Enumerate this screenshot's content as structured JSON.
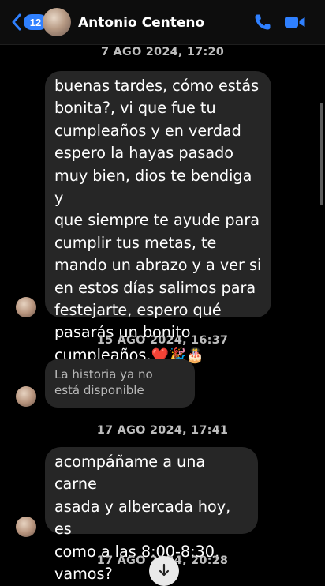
{
  "header": {
    "back_count": "12",
    "contact_name": "Antonio Centeno"
  },
  "messages": [
    {
      "timestamp": "7 AGO 2024, 17:20",
      "text": "buenas tardes, cómo estás\nbonita?, vi que fue tu\ncumpleaños y en verdad\nespero la hayas pasado\nmuy bien, dios te bendiga y\nque siempre te ayude para\ncumplir tus metas, te\nmando un abrazo y a ver si\nen estos días salimos para\nfestejarte, espero qué\npasarás un bonito\ncumpleaños.",
      "emojis": "❤️🎉🎂"
    },
    {
      "timestamp": "15 AGO 2024, 16:37",
      "text": "La historia ya no\nestá disponible"
    },
    {
      "timestamp": "17 AGO 2024, 17:41",
      "text": "acompáñame a una carne\nasada y albercada hoy, es\ncomo a las 8:00-8:30,\nvamos?"
    },
    {
      "timestamp": "17 AGO 2024, 20:28"
    }
  ],
  "colors": {
    "accent": "#2f80ff",
    "bubble": "#262626",
    "background": "#000000"
  },
  "icons": [
    "chevron-left-icon",
    "phone-icon",
    "video-icon",
    "arrow-down-icon"
  ]
}
